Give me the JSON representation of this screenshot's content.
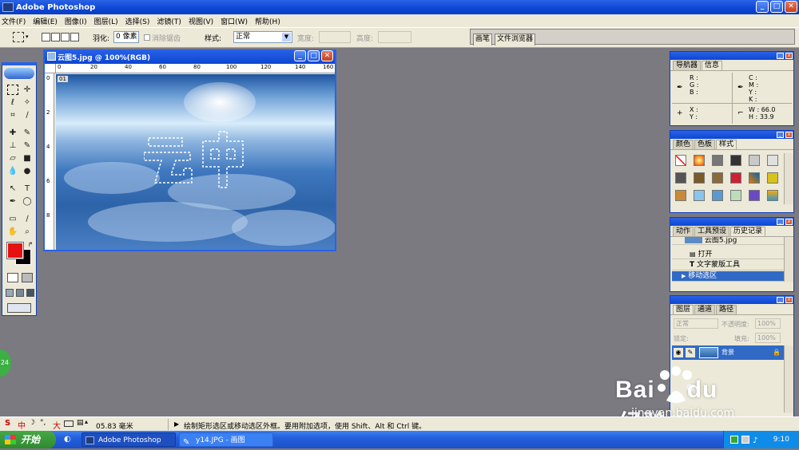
{
  "app": {
    "title": "Adobe Photoshop"
  },
  "menu": [
    "文件(F)",
    "编辑(E)",
    "图像(I)",
    "图层(L)",
    "选择(S)",
    "滤镜(T)",
    "视图(V)",
    "窗口(W)",
    "帮助(H)"
  ],
  "options": {
    "feather_label": "羽化:",
    "feather_value": "0 像素",
    "antialias_label": "消除锯齿",
    "style_label": "样式:",
    "style_value": "正常",
    "width_label": "宽度:",
    "height_label": "高度:"
  },
  "palette_well": {
    "tabs": [
      "画笔",
      "文件浏览器"
    ]
  },
  "document": {
    "title": "云图5.jpg @ 100%(RGB)",
    "ruler_h": [
      "0",
      "20",
      "40",
      "60",
      "80",
      "100",
      "120",
      "140",
      "160"
    ],
    "ruler_v": [
      "0",
      "2",
      "4",
      "6",
      "8"
    ],
    "corner_label": "01"
  },
  "navigator_panel": {
    "tabs": [
      "导航器",
      "信息"
    ],
    "rgb_labels": [
      "R :",
      "G :",
      "B :"
    ],
    "cmyk_labels": [
      "C :",
      "M :",
      "Y :",
      "K :"
    ],
    "xy_labels": [
      "X :",
      "Y :"
    ],
    "w_label": "W :",
    "w_value": "66.0",
    "h_label": "H :",
    "h_value": "33.9"
  },
  "swatches_panel": {
    "tabs": [
      "颜色",
      "色板",
      "样式"
    ]
  },
  "history_panel": {
    "tabs": [
      "动作",
      "工具预设",
      "历史记录"
    ],
    "snapshot": "云图5.jpg",
    "items": [
      "打开",
      "文字蒙版工具",
      "移动选区"
    ]
  },
  "layers_panel": {
    "tabs": [
      "图层",
      "通道",
      "路径"
    ],
    "blend_mode": "正常",
    "opacity_label": "不透明度:",
    "opacity_value": "100%",
    "lock_label": "锁定:",
    "fill_label": "填充:",
    "fill_value": "100%",
    "layer_name": "背景"
  },
  "status": {
    "ime": "中",
    "ime_mode": "大",
    "size": "05.83 毫米",
    "hint": "绘制矩形选区或移动选区外框。要用附加选项，使用 Shift、Alt 和 Ctrl 键。"
  },
  "taskbar": {
    "start": "开始",
    "tasks": [
      "Adobe Photoshop",
      "y14.JPG - 画图"
    ],
    "clock": "9:10"
  },
  "badge": "24",
  "watermark": {
    "brand": "Bai",
    "brand2": "du",
    "jingyan": "经验",
    "url": "jingyan.baidu.com"
  },
  "colors": {
    "foreground": "#e61010",
    "background": "#000000",
    "accent": "#2a62e6"
  }
}
